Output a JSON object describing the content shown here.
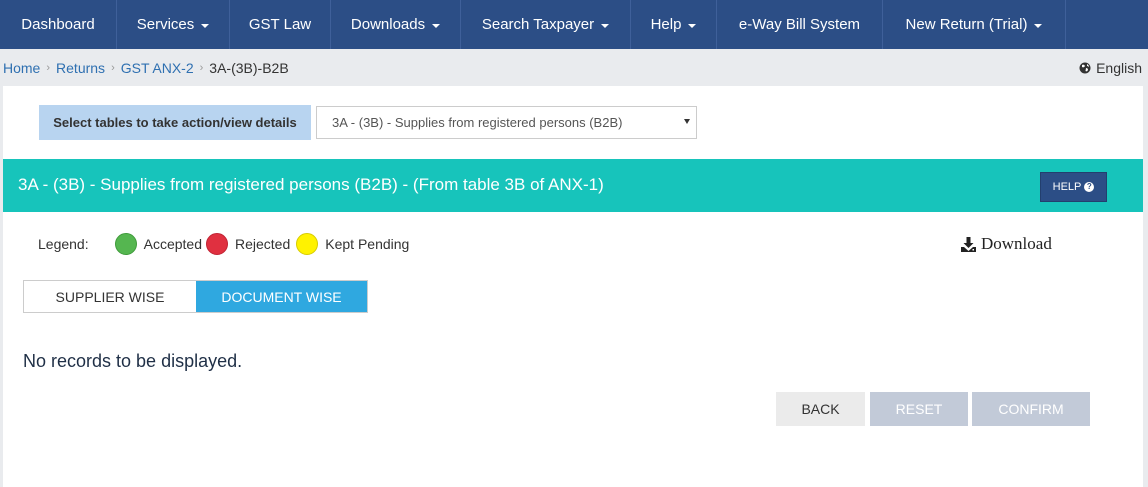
{
  "nav": {
    "items": [
      {
        "label": "Dashboard",
        "dropdown": false
      },
      {
        "label": "Services",
        "dropdown": true
      },
      {
        "label": "GST Law",
        "dropdown": false
      },
      {
        "label": "Downloads",
        "dropdown": true
      },
      {
        "label": "Search Taxpayer",
        "dropdown": true
      },
      {
        "label": "Help",
        "dropdown": true
      },
      {
        "label": "e-Way Bill System",
        "dropdown": false
      },
      {
        "label": "New Return (Trial)",
        "dropdown": true
      }
    ]
  },
  "breadcrumb": {
    "items": [
      "Home",
      "Returns",
      "GST ANX-2"
    ],
    "current": "3A-(3B)-B2B"
  },
  "language": {
    "label": "English",
    "icon": "globe-icon"
  },
  "table_select": {
    "label": "Select tables to take action/view details",
    "selected": "3A - (3B) - Supplies from registered persons (B2B)"
  },
  "section": {
    "title": "3A - (3B) - Supplies from registered persons (B2B) - (From table 3B of ANX-1)",
    "help_label": "HELP",
    "color": "#17c4bb"
  },
  "legend": {
    "label": "Legend:",
    "items": [
      {
        "label": "Accepted",
        "color": "#55b650"
      },
      {
        "label": "Rejected",
        "color": "#e03040"
      },
      {
        "label": "Kept Pending",
        "color": "#fff200"
      }
    ]
  },
  "download": {
    "label": "Download",
    "icon": "download-icon"
  },
  "view_toggle": {
    "options": [
      "SUPPLIER WISE",
      "DOCUMENT WISE"
    ],
    "active": "DOCUMENT WISE"
  },
  "empty_message": "No records to be displayed.",
  "actions": {
    "back": "BACK",
    "reset": "RESET",
    "confirm": "CONFIRM"
  }
}
